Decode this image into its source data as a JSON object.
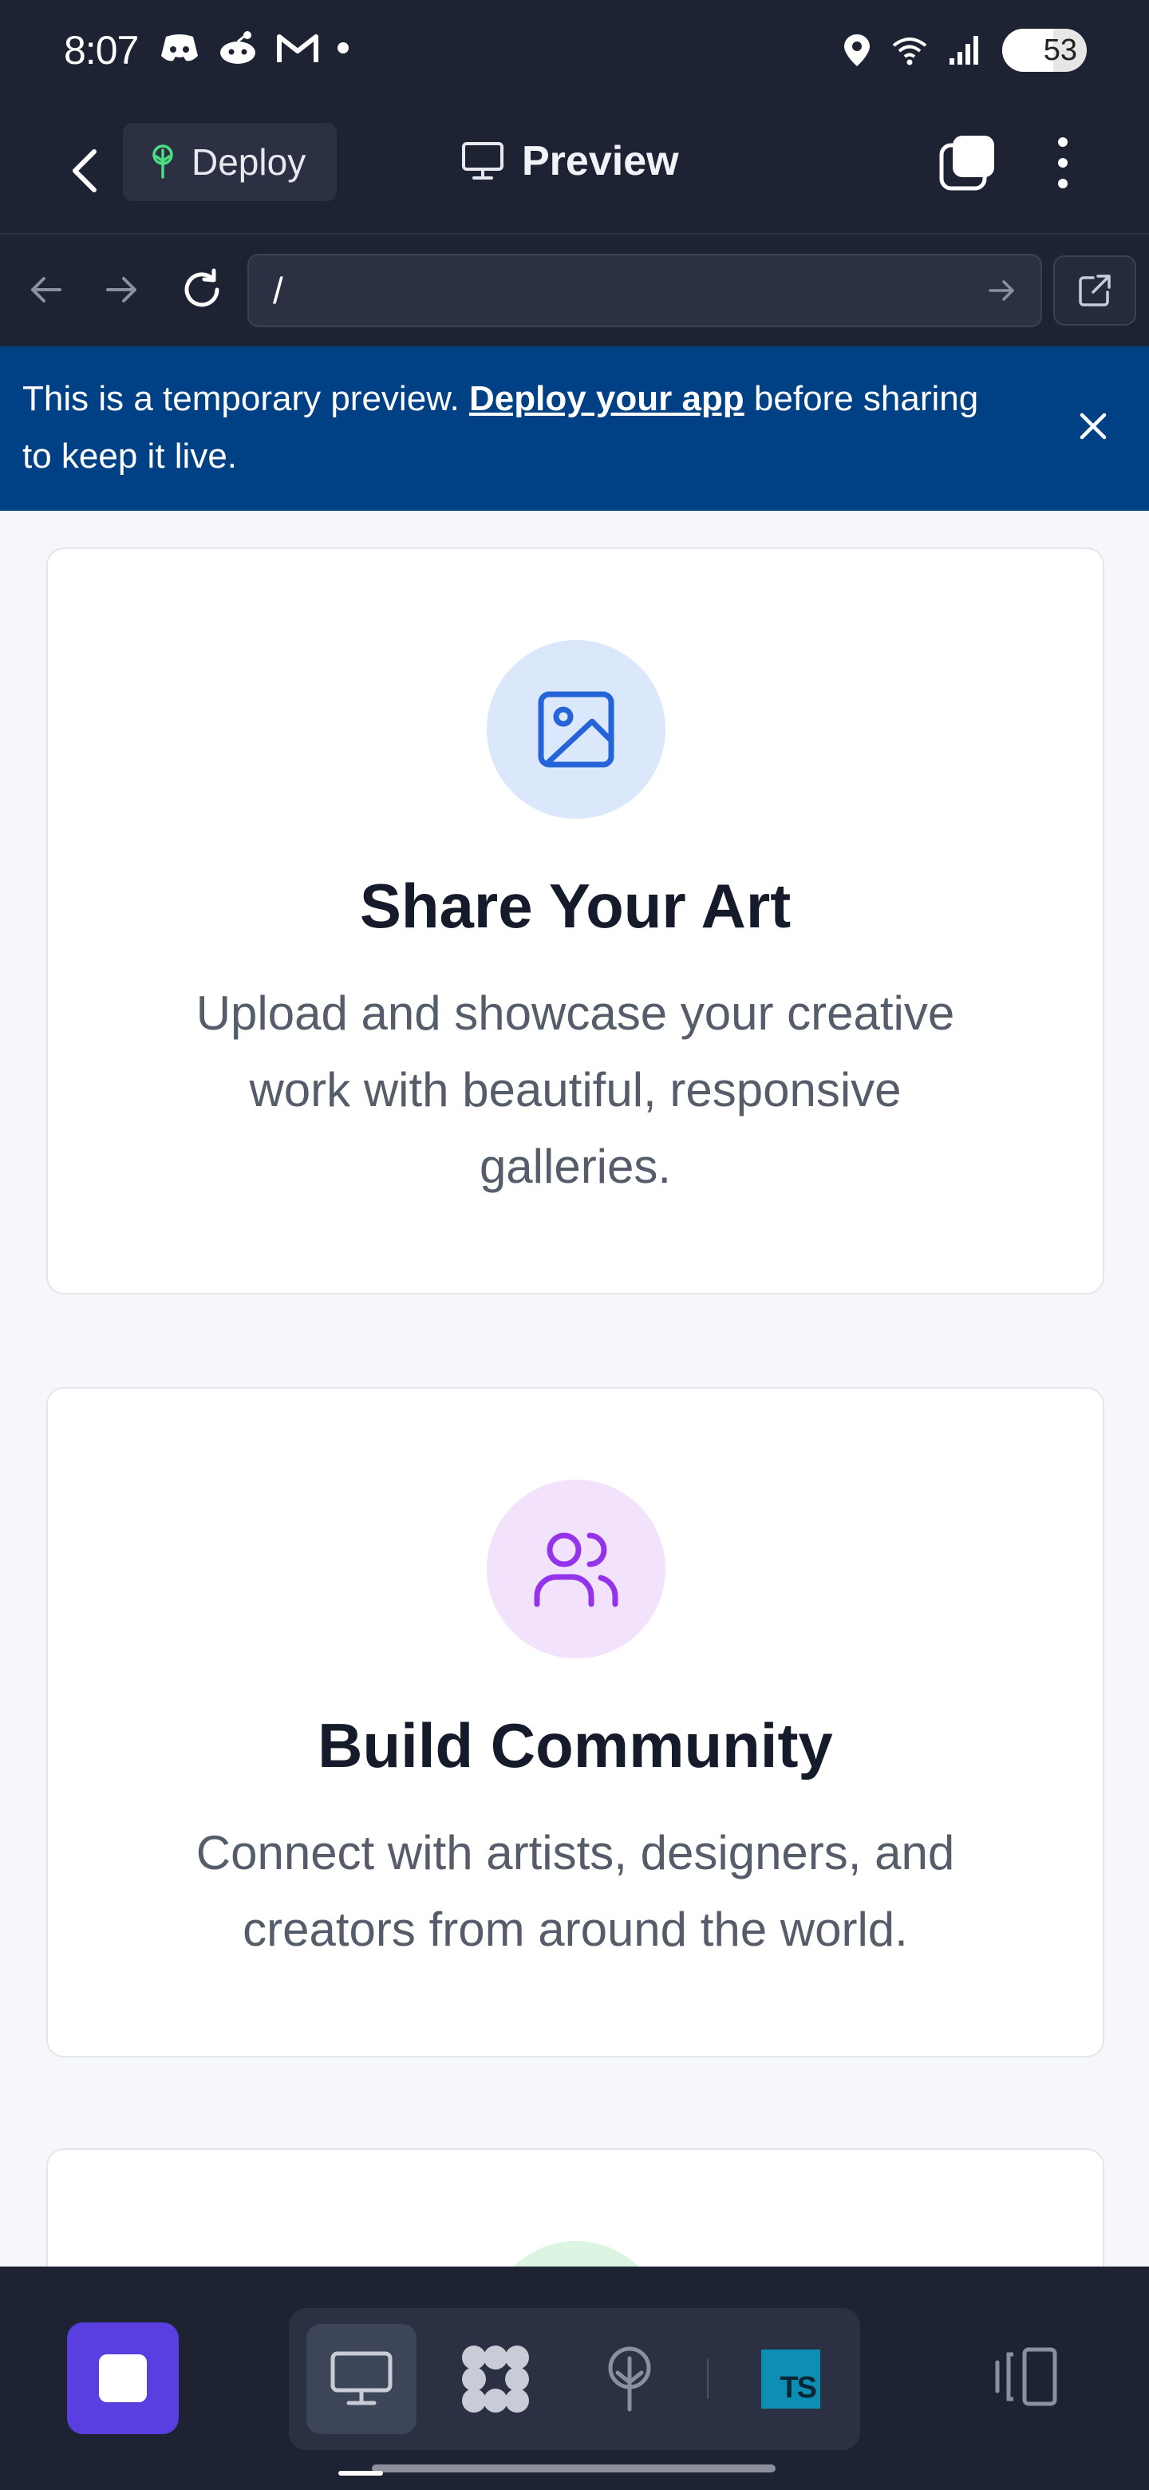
{
  "status_bar": {
    "time": "8:07",
    "battery": "53",
    "left_icons": [
      "discord-icon",
      "reddit-icon",
      "gmail-icon",
      "dot-icon"
    ],
    "right_icons": [
      "location-icon",
      "wifi-icon",
      "signal-icon"
    ]
  },
  "app_bar": {
    "deploy_label": "Deploy",
    "title": "Preview"
  },
  "url_bar": {
    "value": "/"
  },
  "banner": {
    "text_before": "This is a temporary preview. ",
    "link_text": "Deploy your app",
    "text_after": " before sharing to keep it live."
  },
  "cards": [
    {
      "title": "Share Your Art",
      "description": "Upload and showcase your creative work with beautiful, responsive galleries.",
      "icon": "image-icon",
      "icon_color": "#2563d9",
      "icon_bg": "#dbe8fb"
    },
    {
      "title": "Build Community",
      "description": "Connect with artists, designers, and creators from around the world.",
      "icon": "users-icon",
      "icon_color": "#9333ea",
      "icon_bg": "#f2e2fb"
    },
    {
      "icon_bg": "#dcf5e2"
    }
  ],
  "bottom_nav": {
    "tools": [
      "monitor-icon",
      "workflow-icon",
      "deploy-icon",
      "typescript-icon"
    ],
    "ts_label": "TS",
    "accent": "#5a3fe0"
  }
}
